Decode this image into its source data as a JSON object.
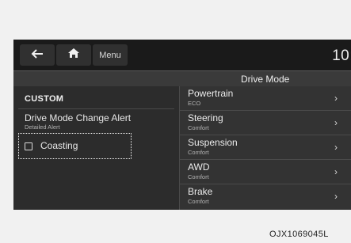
{
  "topbar": {
    "back_icon": "arrow-left-icon",
    "home_icon": "home-icon",
    "menu_label": "Menu",
    "clock": "10:"
  },
  "header": {
    "title": "Drive Mode"
  },
  "left": {
    "section_label": "CUSTOM",
    "alert": {
      "title": "Drive Mode Change Alert",
      "subtitle": "Detailed Alert"
    },
    "coasting": {
      "label": "Coasting",
      "checked": false
    }
  },
  "right": {
    "items": [
      {
        "title": "Powertrain",
        "value": "ECO"
      },
      {
        "title": "Steering",
        "value": "Comfort"
      },
      {
        "title": "Suspension",
        "value": "Comfort"
      },
      {
        "title": "AWD",
        "value": "Comfort"
      },
      {
        "title": "Brake",
        "value": "Comfort"
      }
    ],
    "chevron": "›"
  },
  "caption": "OJX1069045L"
}
